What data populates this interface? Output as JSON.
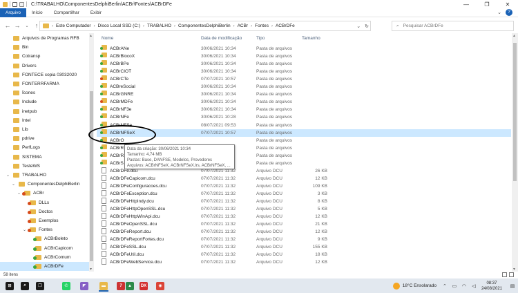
{
  "window": {
    "title": "C:\\TRABALHO\\ComponentesDelphiBerlin\\ACBr\\Fontes\\ACBrDFe",
    "minimize": "—",
    "maximize": "❐",
    "close": "✕"
  },
  "ribbon": {
    "tabs": [
      {
        "label": "Arquivo",
        "active": true
      },
      {
        "label": "Início",
        "active": false
      },
      {
        "label": "Compartilhar",
        "active": false
      },
      {
        "label": "Exibir",
        "active": false
      }
    ],
    "help": "?"
  },
  "address": {
    "crumbs": [
      "Este Computador",
      "Disco Local SSD (C:)",
      "TRABALHO",
      "ComponentesDelphiBerlin",
      "ACBr",
      "Fontes",
      "ACBrDFe"
    ],
    "search_placeholder": "Pesquisar ACBrDFe"
  },
  "nav_tree": [
    {
      "label": "Arquivos de Programas RFB",
      "indent": 0,
      "icon": "folder"
    },
    {
      "label": "Bin",
      "indent": 0,
      "icon": "folder"
    },
    {
      "label": "Cotransp",
      "indent": 0,
      "icon": "folder"
    },
    {
      "label": "Drivers",
      "indent": 0,
      "icon": "folder"
    },
    {
      "label": "FONTECE copia 03032020",
      "indent": 0,
      "icon": "folder"
    },
    {
      "label": "FONTERRFARMA",
      "indent": 0,
      "icon": "folder"
    },
    {
      "label": "Ícones",
      "indent": 0,
      "icon": "folder"
    },
    {
      "label": "Include",
      "indent": 0,
      "icon": "folder"
    },
    {
      "label": "inetpub",
      "indent": 0,
      "icon": "folder"
    },
    {
      "label": "Intel",
      "indent": 0,
      "icon": "folder"
    },
    {
      "label": "Lib",
      "indent": 0,
      "icon": "folder"
    },
    {
      "label": "pdrive",
      "indent": 0,
      "icon": "folder"
    },
    {
      "label": "PerfLogs",
      "indent": 0,
      "icon": "folder"
    },
    {
      "label": "SISTEMA",
      "indent": 0,
      "icon": "folder"
    },
    {
      "label": "TesteWS",
      "indent": 0,
      "icon": "folder"
    },
    {
      "label": "TRABALHO",
      "indent": 0,
      "icon": "folder",
      "expanded": true
    },
    {
      "label": "ComponentesDelphiBerlin",
      "indent": 1,
      "icon": "folder",
      "expanded": true
    },
    {
      "label": "ACBr",
      "indent": 2,
      "icon": "gear",
      "expanded": true
    },
    {
      "label": "DLLs",
      "indent": 3,
      "icon": "gear"
    },
    {
      "label": "Doctos",
      "indent": 3,
      "icon": "gear"
    },
    {
      "label": "Exemplos",
      "indent": 3,
      "icon": "gear"
    },
    {
      "label": "Fontes",
      "indent": 3,
      "icon": "gear",
      "expanded": true
    },
    {
      "label": "ACBrBoleto",
      "indent": 4,
      "icon": "green"
    },
    {
      "label": "ACBrCapicom",
      "indent": 4,
      "icon": "green"
    },
    {
      "label": "ACBrComum",
      "indent": 4,
      "icon": "green"
    },
    {
      "label": "ACBrDFe",
      "indent": 4,
      "icon": "green",
      "selected": true
    }
  ],
  "columns": {
    "name": "Nome",
    "date": "Data de modificação",
    "type": "Tipo",
    "size": "Tamanho"
  },
  "files": [
    {
      "name": "ACBrANe",
      "date": "30/06/2021 10:34",
      "type": "Pasta de arquivos",
      "size": "",
      "kind": "folder"
    },
    {
      "name": "ACBrBlocoX",
      "date": "30/06/2021 10:34",
      "type": "Pasta de arquivos",
      "size": "",
      "kind": "folder"
    },
    {
      "name": "ACBrBPe",
      "date": "30/06/2021 10:34",
      "type": "Pasta de arquivos",
      "size": "",
      "kind": "folder"
    },
    {
      "name": "ACBrCIOT",
      "date": "30/06/2021 10:34",
      "type": "Pasta de arquivos",
      "size": "",
      "kind": "folder"
    },
    {
      "name": "ACBrCTe",
      "date": "07/07/2021 10:57",
      "type": "Pasta de arquivos",
      "size": "",
      "kind": "folder-red"
    },
    {
      "name": "ACBreSocial",
      "date": "30/06/2021 10:34",
      "type": "Pasta de arquivos",
      "size": "",
      "kind": "folder"
    },
    {
      "name": "ACBrGNRE",
      "date": "30/06/2021 10:34",
      "type": "Pasta de arquivos",
      "size": "",
      "kind": "folder"
    },
    {
      "name": "ACBrMDFe",
      "date": "30/06/2021 10:34",
      "type": "Pasta de arquivos",
      "size": "",
      "kind": "folder-red"
    },
    {
      "name": "ACBrNF3e",
      "date": "30/06/2021 10:34",
      "type": "Pasta de arquivos",
      "size": "",
      "kind": "folder"
    },
    {
      "name": "ACBrNFe",
      "date": "30/06/2021 10:28",
      "type": "Pasta de arquivos",
      "size": "",
      "kind": "folder"
    },
    {
      "name": "ACBrNFSe",
      "date": "08/07/2021 09:53",
      "type": "Pasta de arquivos",
      "size": "",
      "kind": "folder"
    },
    {
      "name": "ACBrNFSeX",
      "date": "07/07/2021 10:57",
      "type": "Pasta de arquivos",
      "size": "",
      "kind": "folder",
      "selected": true
    },
    {
      "name": "ACBrO",
      "date": "",
      "type": "Pasta de arquivos",
      "size": "",
      "kind": "folder"
    },
    {
      "name": "ACBrR",
      "date": "",
      "type": "Pasta de arquivos",
      "size": "",
      "kind": "folder"
    },
    {
      "name": "ACBrR",
      "date": "",
      "type": "Pasta de arquivos",
      "size": "",
      "kind": "folder"
    },
    {
      "name": "ACBrS",
      "date": "",
      "type": "Pasta de arquivos",
      "size": "",
      "kind": "folder"
    },
    {
      "name": "ACBrDFe.dcu",
      "date": "07/07/2021 11:32",
      "type": "Arquivo DCU",
      "size": "26 KB",
      "kind": "file"
    },
    {
      "name": "ACBrDFeCapicom.dcu",
      "date": "07/07/2021 11:32",
      "type": "Arquivo DCU",
      "size": "12 KB",
      "kind": "file"
    },
    {
      "name": "ACBrDFeConfiguracoes.dcu",
      "date": "07/07/2021 11:32",
      "type": "Arquivo DCU",
      "size": "109 KB",
      "kind": "file"
    },
    {
      "name": "ACBrDFeException.dcu",
      "date": "07/07/2021 11:32",
      "type": "Arquivo DCU",
      "size": "3 KB",
      "kind": "file"
    },
    {
      "name": "ACBrDFeHttpIndy.dcu",
      "date": "07/07/2021 11:32",
      "type": "Arquivo DCU",
      "size": "8 KB",
      "kind": "file"
    },
    {
      "name": "ACBrDFeHttpOpenSSL.dcu",
      "date": "07/07/2021 11:32",
      "type": "Arquivo DCU",
      "size": "5 KB",
      "kind": "file"
    },
    {
      "name": "ACBrDFeHttpWinApi.dcu",
      "date": "07/07/2021 11:32",
      "type": "Arquivo DCU",
      "size": "12 KB",
      "kind": "file"
    },
    {
      "name": "ACBrDFeOpenSSL.dcu",
      "date": "07/07/2021 11:32",
      "type": "Arquivo DCU",
      "size": "21 KB",
      "kind": "file"
    },
    {
      "name": "ACBrDFeReport.dcu",
      "date": "07/07/2021 11:32",
      "type": "Arquivo DCU",
      "size": "12 KB",
      "kind": "file"
    },
    {
      "name": "ACBrDFeReportFortes.dcu",
      "date": "07/07/2021 11:32",
      "type": "Arquivo DCU",
      "size": "9 KB",
      "kind": "file"
    },
    {
      "name": "ACBrDFeSSL.dcu",
      "date": "07/07/2021 11:32",
      "type": "Arquivo DCU",
      "size": "155 KB",
      "kind": "file"
    },
    {
      "name": "ACBrDFeUtil.dcu",
      "date": "07/07/2021 11:32",
      "type": "Arquivo DCU",
      "size": "18 KB",
      "kind": "file"
    },
    {
      "name": "ACBrDFeWebService.dcu",
      "date": "07/07/2021 11:32",
      "type": "Arquivo DCU",
      "size": "12 KB",
      "kind": "file"
    }
  ],
  "tooltip": {
    "lines": [
      "Data da criação: 30/06/2021 10:34",
      "Tamanho: 4,74 MB",
      "Pastas: Base, DANFSE, Modelos, Provedores",
      "Arquivos: ACBrNFSeX, ACBrNFSeX.lrs, ACBrNFSeX, ..."
    ]
  },
  "status": {
    "items": "58 itens"
  },
  "taskbar": {
    "weather": "18°C  Ensolarado",
    "time": "08:37",
    "date": "24/08/2021",
    "apps": [
      {
        "name": "start",
        "glyph": "⊞",
        "color": "#1a1a1a"
      },
      {
        "name": "search",
        "glyph": "⌕",
        "color": "#1a1a1a"
      },
      {
        "name": "task-view",
        "glyph": "❐",
        "color": "#1a1a1a"
      },
      {
        "name": "whatsapp",
        "glyph": "✆",
        "color": "#25d366"
      },
      {
        "name": "visual-studio",
        "glyph": "◤",
        "color": "#865fc5"
      },
      {
        "name": "file-explorer",
        "glyph": "▬",
        "color": "#e8b84a",
        "active": true
      },
      {
        "name": "delphi",
        "glyph": "7",
        "color": "#c33"
      },
      {
        "name": "app-x",
        "glyph": "▲",
        "color": "#2c8a4a"
      },
      {
        "name": "dx",
        "glyph": "DX",
        "color": "#d32f2f"
      },
      {
        "name": "chrome",
        "glyph": "◉",
        "color": "#db4437"
      }
    ]
  }
}
